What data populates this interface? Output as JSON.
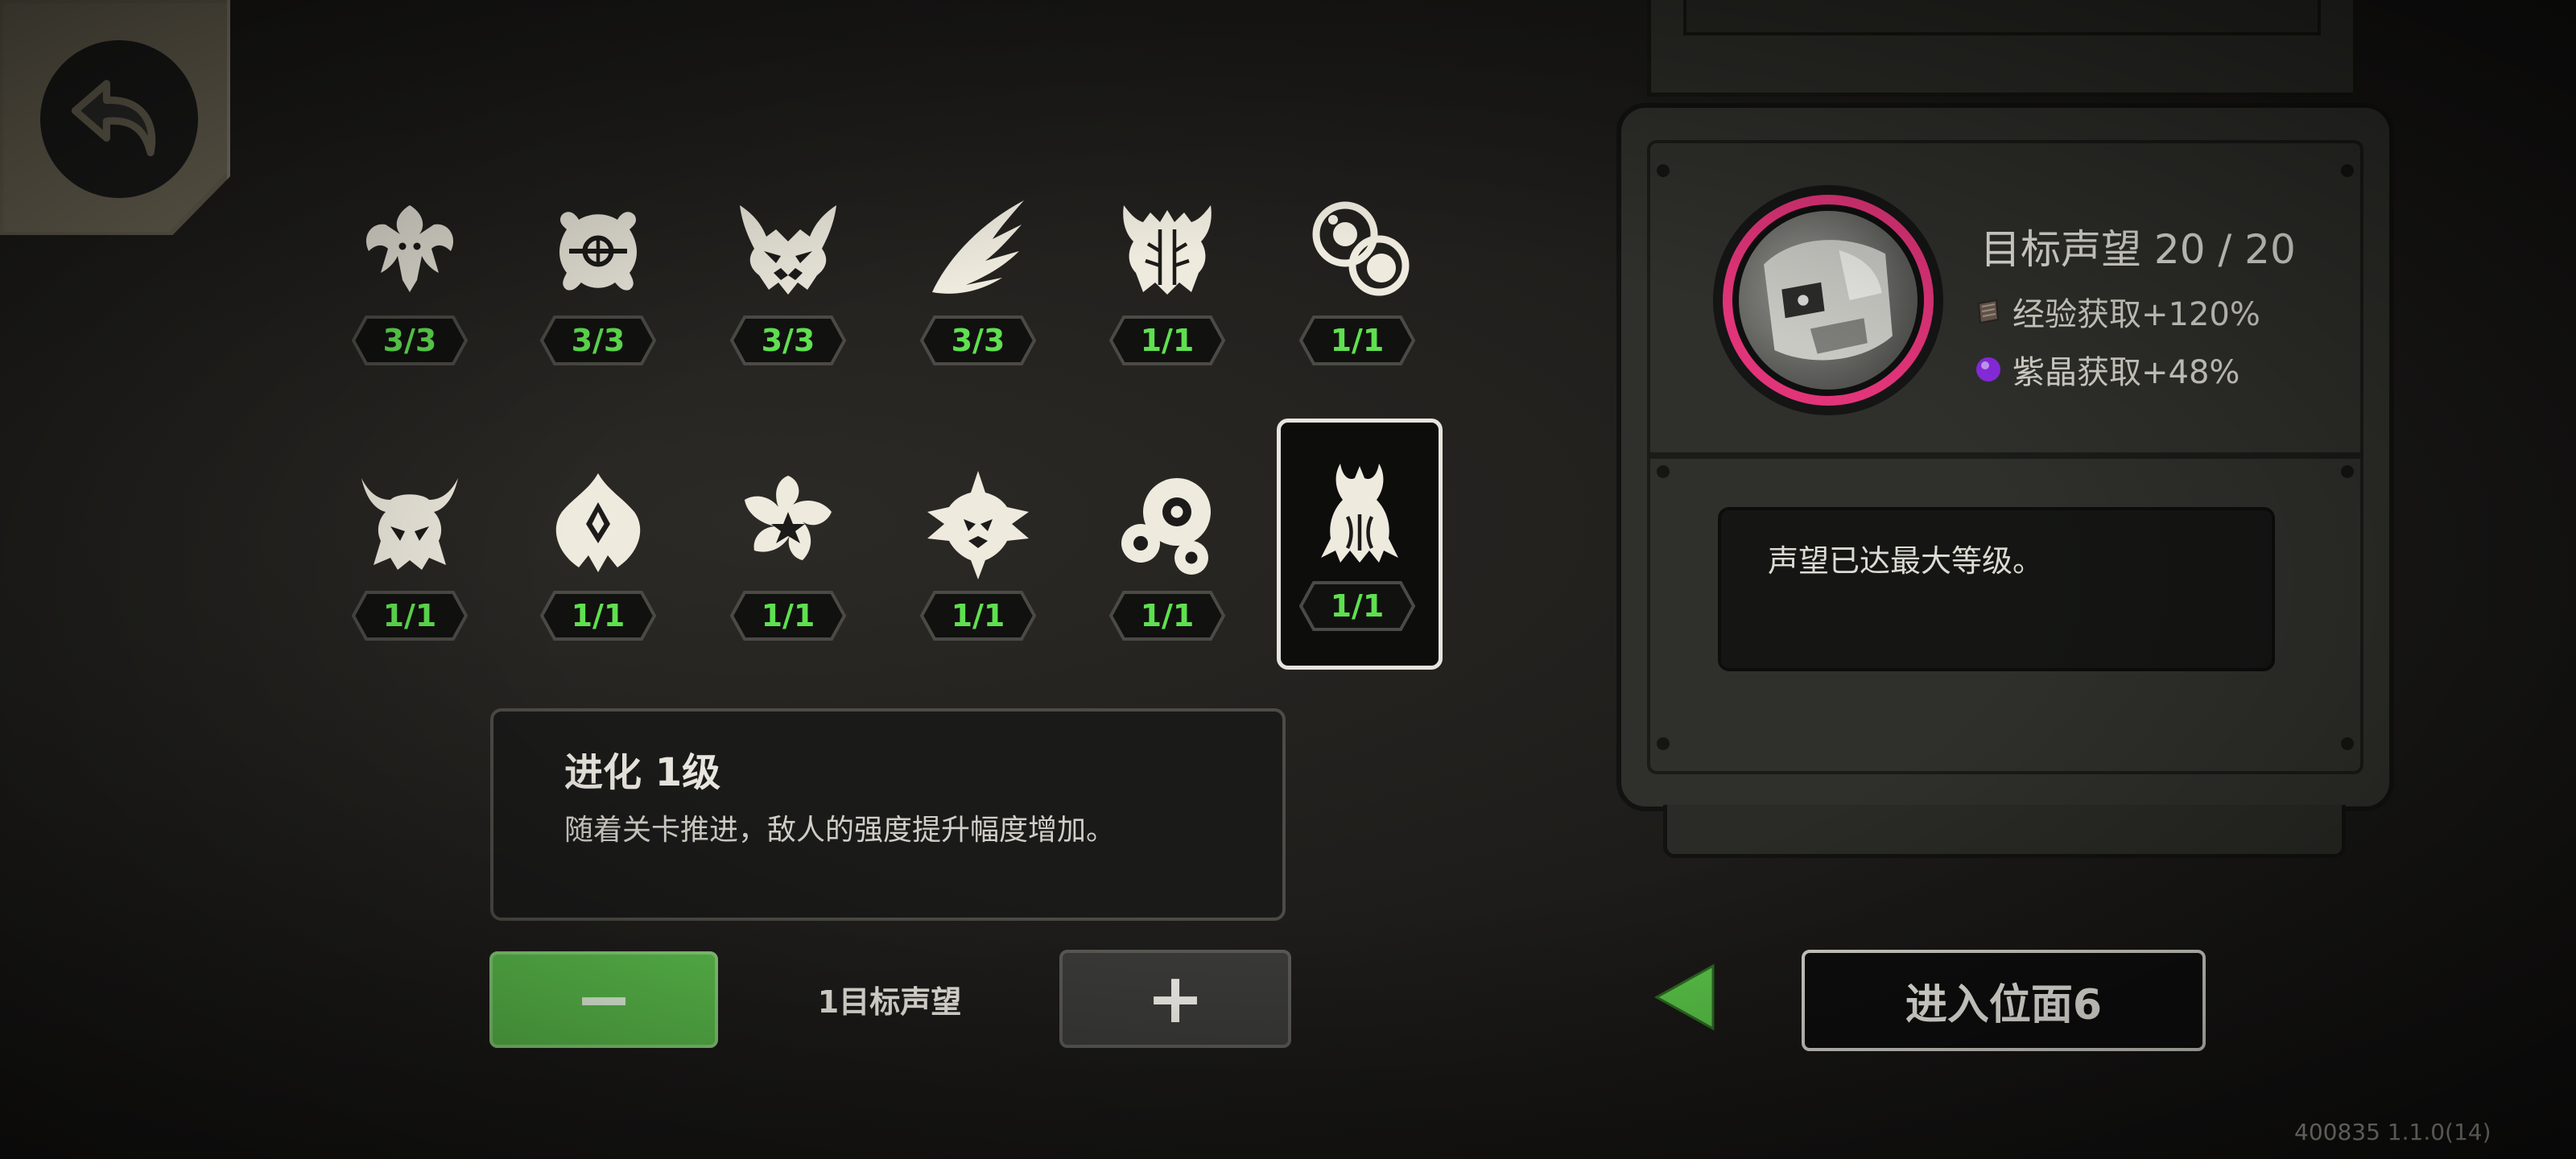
{
  "back": {
    "icon": "back-arrow-icon"
  },
  "upgrades": {
    "row1": [
      {
        "icon": "swarm-creature-icon",
        "level": "3/3"
      },
      {
        "icon": "crosshair-blob-icon",
        "level": "3/3"
      },
      {
        "icon": "demon-mask-icon",
        "level": "3/3"
      },
      {
        "icon": "claw-slash-icon",
        "level": "3/3"
      },
      {
        "icon": "armored-beast-icon",
        "level": "1/1"
      },
      {
        "icon": "cell-cluster-icon",
        "level": "1/1"
      }
    ],
    "row2": [
      {
        "icon": "horned-skull-icon",
        "level": "1/1"
      },
      {
        "icon": "crystal-flame-icon",
        "level": "1/1"
      },
      {
        "icon": "spiral-star-icon",
        "level": "1/1"
      },
      {
        "icon": "spiked-star-icon",
        "level": "1/1"
      },
      {
        "icon": "eye-cluster-icon",
        "level": "1/1"
      },
      {
        "icon": "evolution-claw-icon",
        "level": "1/1",
        "selected": true
      }
    ]
  },
  "description": {
    "title": "进化 1级",
    "body": "随着关卡推进，敌人的强度提升幅度增加。"
  },
  "stepper": {
    "minus_label": "−",
    "plus_label": "+",
    "value_label": "1目标声望"
  },
  "prestige": {
    "title": "目标声望 20 / 20",
    "exp_bonus": "经验获取+120%",
    "crystal_bonus": "紫晶获取+48%",
    "info": "声望已达最大等级。",
    "ring_color": "#e23479"
  },
  "enter": {
    "label": "进入位面6",
    "arrow_color": "#5cc94a"
  },
  "version": "400835 1.1.0(14)"
}
